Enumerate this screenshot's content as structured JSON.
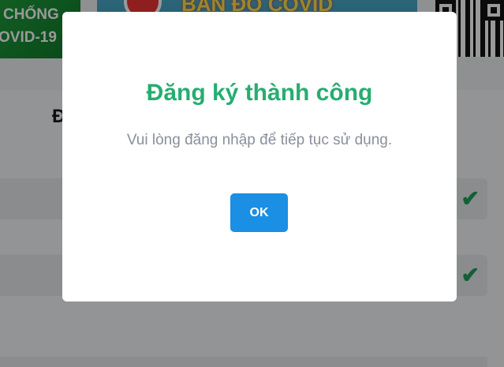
{
  "banners": {
    "left_line1": "CHỐNG",
    "left_line2": "OVID-19",
    "middle_text": "BẢN ĐỒ COVID"
  },
  "form": {
    "heading_partial": "Đ",
    "check_mark": "✔"
  },
  "dialog": {
    "title": "Đăng ký thành công",
    "message": "Vui lòng đăng nhập để tiếp tục sử dụng.",
    "ok_label": "OK"
  },
  "colors": {
    "title_green": "#27ad72",
    "ok_blue": "#1a8fe3",
    "check_green": "#21a05d"
  }
}
